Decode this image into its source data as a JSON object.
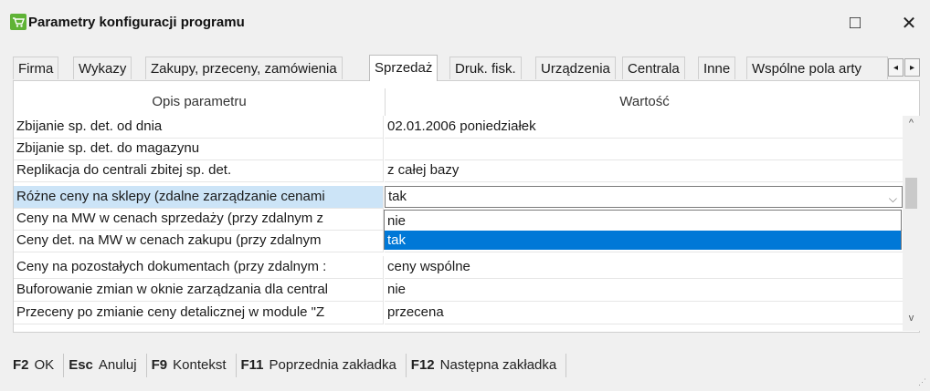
{
  "window": {
    "title": "Parametry konfiguracji programu",
    "maximize_icon": "□",
    "close_icon": "✕"
  },
  "tabs": [
    {
      "label": "Firma"
    },
    {
      "label": "Wykazy"
    },
    {
      "label": "Zakupy, przeceny, zamówienia"
    },
    {
      "label": "Sprzedaż",
      "active": true
    },
    {
      "label": "Druk. fisk."
    },
    {
      "label": "Urządzenia"
    },
    {
      "label": "Centrala"
    },
    {
      "label": "Inne"
    },
    {
      "label": "Wspólne pola arty"
    }
  ],
  "tab_nav": {
    "prev": "◂",
    "next": "▸"
  },
  "grid": {
    "header_desc": "Opis parametru",
    "header_value": "Wartość",
    "rows": [
      {
        "desc": "Zbijanie sp. det. od dnia",
        "value": "02.01.2006 poniedziałek"
      },
      {
        "desc": "Zbijanie sp. det. do magazynu",
        "value": ""
      },
      {
        "desc": "Replikacja do centrali zbitej sp. det.",
        "value": "z całej bazy"
      },
      {
        "desc": "Różne ceny na sklepy (zdalne zarządzanie cenami",
        "value": "tak",
        "selected": true,
        "editing": true
      },
      {
        "desc": "Ceny na MW w cenach sprzedaży (przy zdalnym z",
        "value": ""
      },
      {
        "desc": "Ceny det. na MW w cenach zakupu (przy zdalnym",
        "value": ""
      },
      {
        "desc": "Ceny na pozostałych dokumentach (przy zdalnym :",
        "value": "ceny wspólne"
      },
      {
        "desc": "Buforowanie zmian w oknie zarządzania dla central",
        "value": "nie"
      },
      {
        "desc": "Przeceny po zmianie ceny detalicznej w module \"Z",
        "value": "przecena"
      }
    ]
  },
  "dropdown": {
    "options": [
      "nie",
      "tak"
    ],
    "highlighted": "tak"
  },
  "scrollbar": {
    "up": "^",
    "down": "v"
  },
  "statusbar": [
    {
      "key": "F2",
      "label": "OK"
    },
    {
      "key": "Esc",
      "label": "Anuluj"
    },
    {
      "key": "F9",
      "label": "Kontekst"
    },
    {
      "key": "F11",
      "label": "Poprzednia zakładka"
    },
    {
      "key": "F12",
      "label": "Następna zakładka"
    }
  ],
  "colors": {
    "selection": "#cce4f7",
    "dropdown_highlight": "#0078d7",
    "app_icon": "#5fb336"
  }
}
